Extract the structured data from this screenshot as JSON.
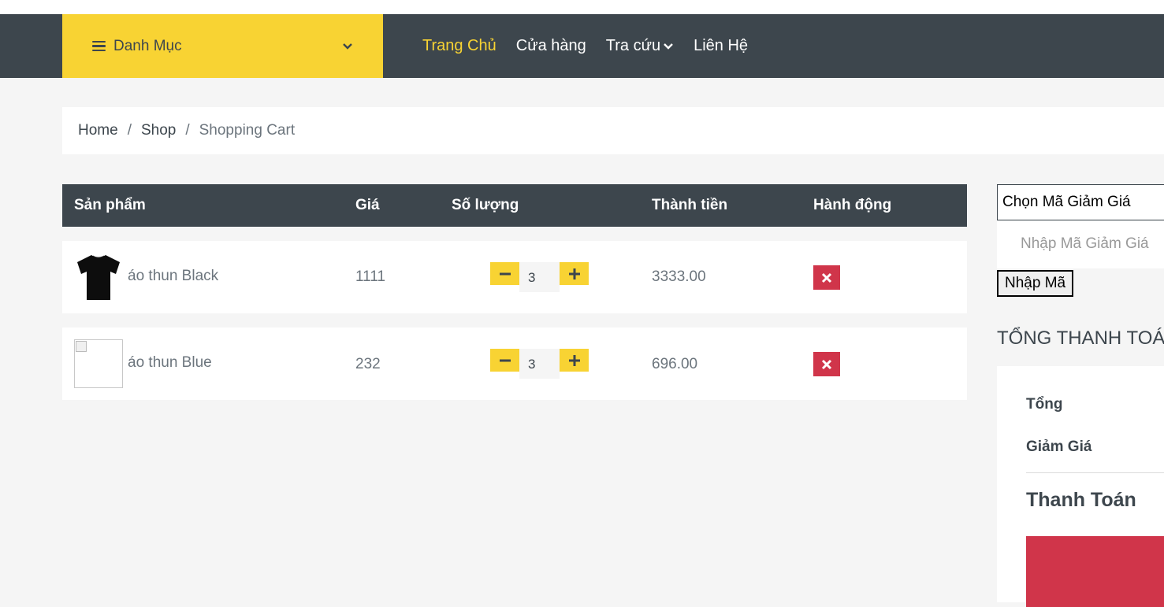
{
  "header": {
    "category_label": "Danh Mục",
    "nav": [
      {
        "label": "Trang Chủ",
        "active": true
      },
      {
        "label": "Cửa hàng",
        "active": false
      },
      {
        "label": "Tra cứu",
        "active": false,
        "has_dropdown": true
      },
      {
        "label": "Liên Hệ",
        "active": false
      }
    ]
  },
  "breadcrumb": {
    "items": [
      "Home",
      "Shop"
    ],
    "separator": "/",
    "current": "Shopping Cart"
  },
  "cart": {
    "columns": [
      "Sản phẩm",
      "Giá",
      "Số lượng",
      "Thành tiền",
      "Hành động"
    ],
    "rows": [
      {
        "name": "áo thun Black",
        "price": "1111",
        "qty": "3",
        "total": "3333.00",
        "image": "black-tshirt"
      },
      {
        "name": "áo thun Blue",
        "price": "232",
        "qty": "3",
        "total": "696.00",
        "image": "broken-image"
      }
    ]
  },
  "coupon": {
    "select_value": "Chọn Mã Giảm Giá",
    "input_placeholder": "Nhập Mã Giảm Giá",
    "apply_label": "Nhập Mã"
  },
  "summary": {
    "title": "TỔNG THANH TOÁN",
    "subtotal_label": "Tổng",
    "discount_label": "Giảm Giá",
    "grand_label": "Thanh Toán"
  },
  "colors": {
    "accent_yellow": "#f8d333",
    "dark": "#3d464d",
    "danger": "#d0354a",
    "background": "#f5f5f5"
  },
  "icons": [
    "menu-icon",
    "chevron-down-icon",
    "minus-icon",
    "plus-icon",
    "close-icon"
  ]
}
